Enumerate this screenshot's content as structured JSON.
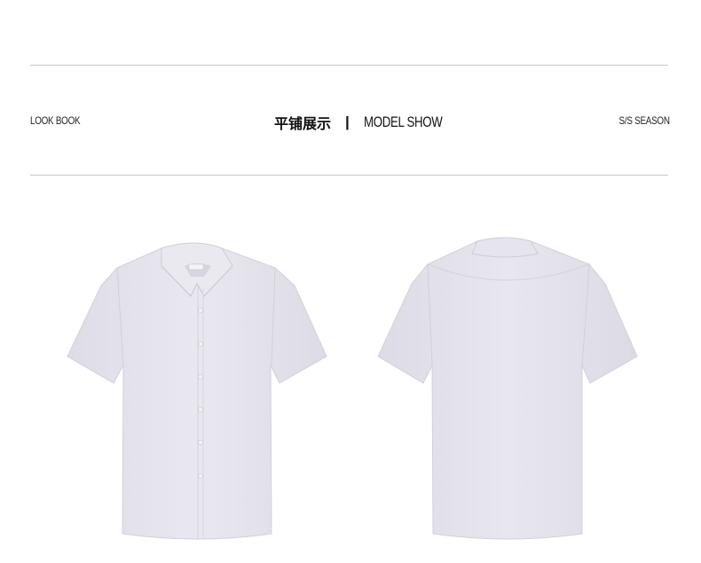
{
  "header": {
    "left_label": "LOOK BOOK",
    "title_cn": "平铺展示",
    "separator": "|",
    "title_en": "MODEL SHOW",
    "right_label": "S/S SEASON"
  },
  "images": [
    {
      "name": "shirt-front",
      "description_color": "#e4e2ea"
    },
    {
      "name": "shirt-back",
      "description_color": "#e4e2ea"
    }
  ],
  "colors": {
    "rule": "#c9c9c9",
    "text": "#222222",
    "shirt": "#e5e3eb",
    "shirt_shadow": "#d6d3de"
  }
}
